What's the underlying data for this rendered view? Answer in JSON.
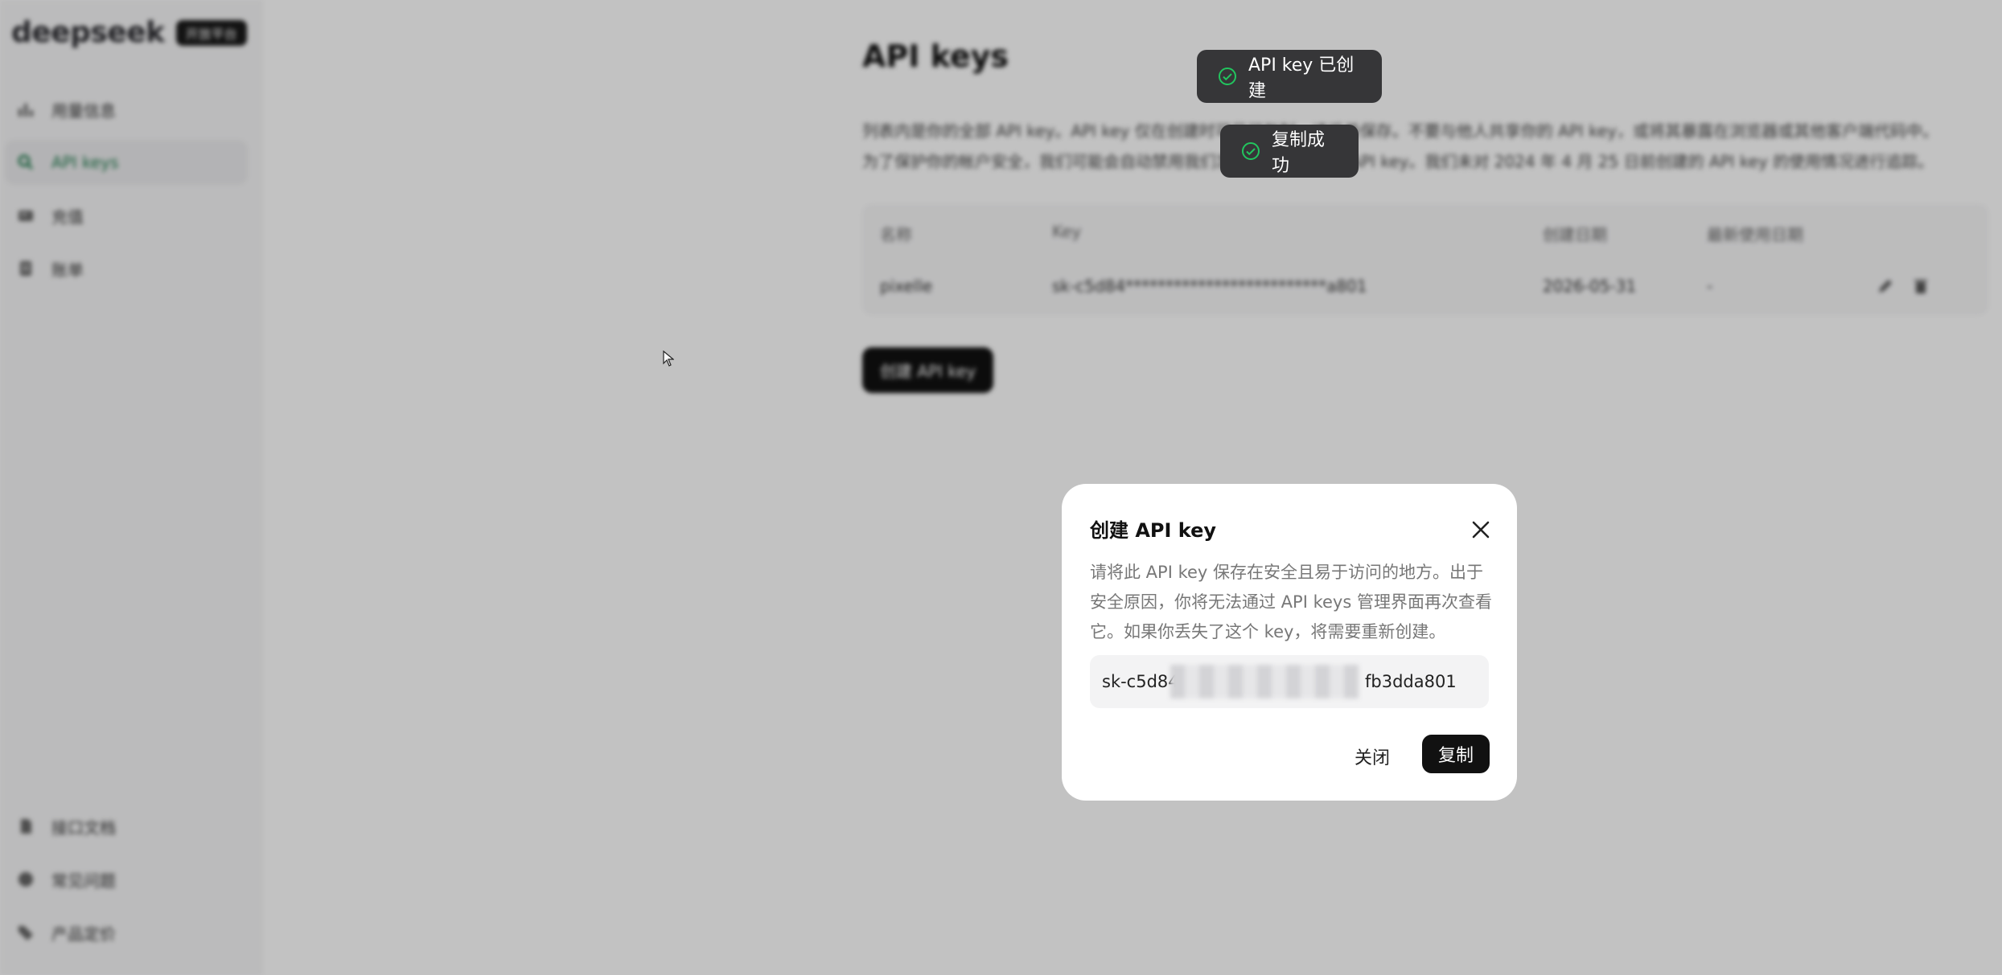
{
  "sidebar": {
    "brand_name": "deepseek",
    "brand_badge": "开放平台",
    "items": [
      {
        "label": "用量信息",
        "icon": "bar-chart-icon"
      },
      {
        "label": "API keys",
        "icon": "search-icon"
      },
      {
        "label": "充值",
        "icon": "wallet-icon"
      },
      {
        "label": "账单",
        "icon": "receipt-icon"
      }
    ],
    "bottom_items": [
      {
        "label": "接口文档",
        "icon": "document-icon"
      },
      {
        "label": "常见问题",
        "icon": "help-icon"
      },
      {
        "label": "产品定价",
        "icon": "tag-icon"
      }
    ]
  },
  "main": {
    "title": "API keys",
    "description_line1": "列表内是你的全部 API key。API key 仅在创建时可见可复制，请妥善保存。不要与他人共享你的 API key，或将其暴露在浏览器或其他客户端代码中。",
    "description_line2": "为了保护你的帐户安全，我们可能会自动禁用我们发现已公开泄露的 API key。我们未对 2024 年 4 月 25 日前创建的 API key 的使用情况进行追踪。",
    "table": {
      "headers": [
        "名称",
        "Key",
        "创建日期",
        "最新使用日期"
      ],
      "rows": [
        {
          "name": "pixelle",
          "key": "sk-c5d84*************************a801",
          "created": "2026-05-31",
          "last_used": "-"
        }
      ]
    },
    "create_button": "创建 API key"
  },
  "toasts": [
    {
      "text": "API key 已创建",
      "icon": "check-circle-icon"
    },
    {
      "text": "复制成功",
      "icon": "check-circle-icon"
    }
  ],
  "dialog": {
    "title": "创建 API key",
    "description_line1": "请将此 API key 保存在安全且易于访问的地方。出于",
    "description_line2": "安全原因，你将无法通过 API keys 管理界面再次查看",
    "description_line3": "它。如果你丢失了这个 key，将需要重新创建。",
    "key_prefix": "sk-c5d84",
    "key_suffix": "fb3dda801",
    "close_label": "关闭",
    "copy_label": "复制"
  },
  "colors": {
    "accent": "#1f7a4c",
    "primary_button": "#111111",
    "toast_bg": "#363638",
    "success_icon": "#22c55e"
  }
}
